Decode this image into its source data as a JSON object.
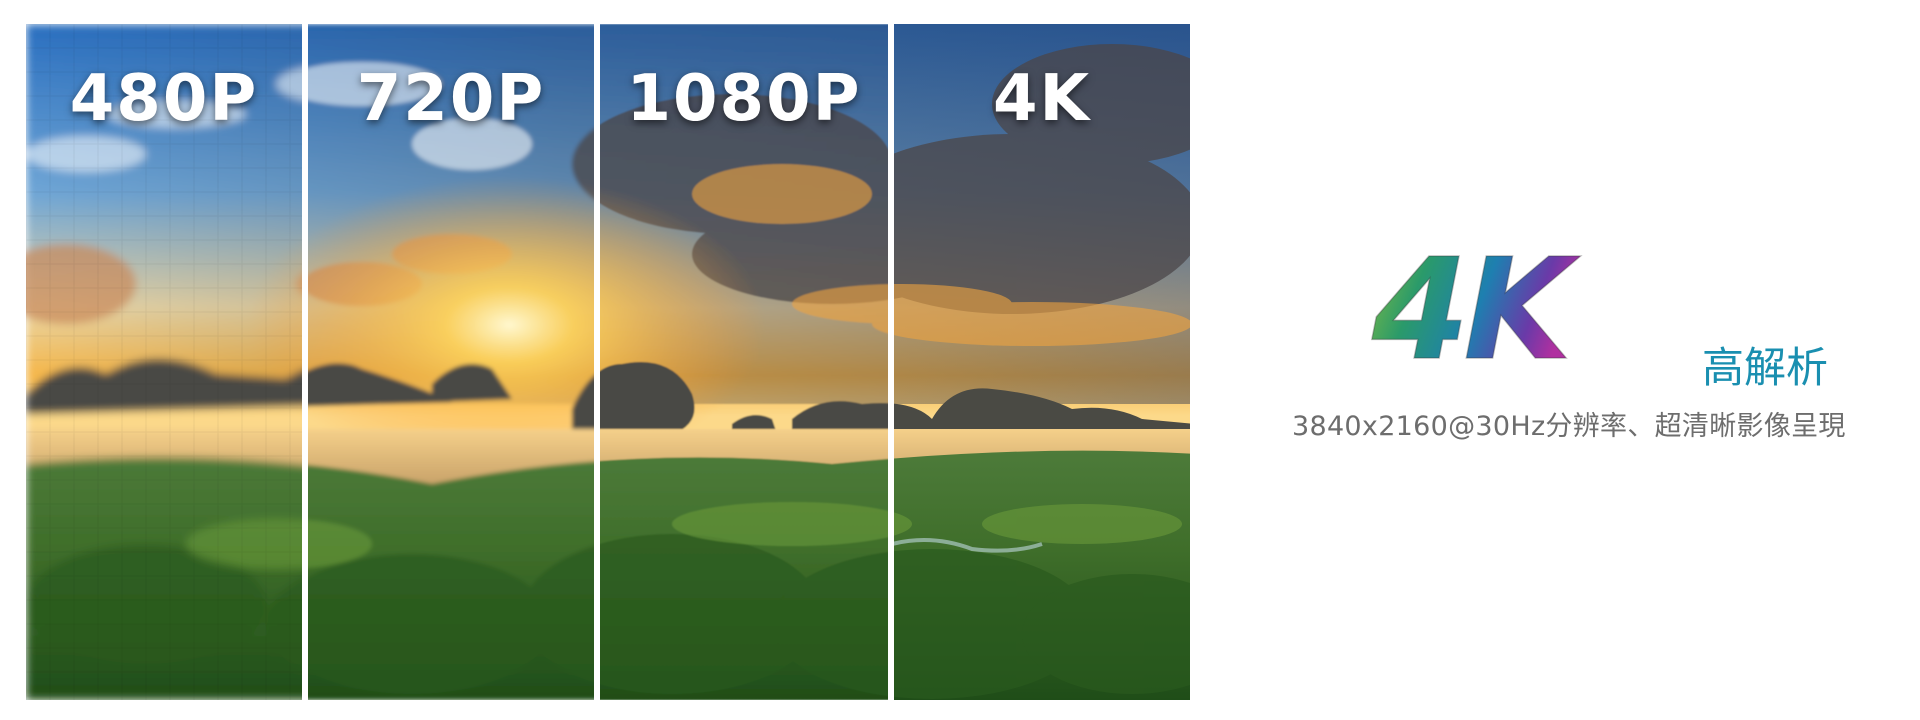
{
  "panels": [
    {
      "label": "480P",
      "blur": 4.2,
      "pixel": true
    },
    {
      "label": "720P",
      "blur": 2.2,
      "pixel": false
    },
    {
      "label": "1080P",
      "blur": 0.8,
      "pixel": false
    },
    {
      "label": "4K",
      "blur": 0,
      "pixel": false
    }
  ],
  "promo": {
    "logo_text": "4K",
    "logo_subtitle": "高解析",
    "tagline": "3840x2160@30Hz分辨率、超清晰影像呈現"
  },
  "colors": {
    "logo_gradient": [
      "#8fc23c",
      "#2a9a6a",
      "#1e7fb0",
      "#6a3aa8",
      "#b030a0"
    ],
    "subtitle": "#1a8fb0",
    "tagline": "#6d6d6d"
  }
}
